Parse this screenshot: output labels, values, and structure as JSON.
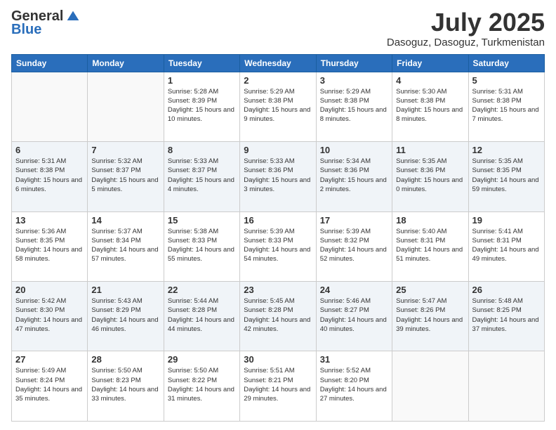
{
  "logo": {
    "general": "General",
    "blue": "Blue"
  },
  "title": {
    "month": "July 2025",
    "location": "Dasoguz, Dasoguz, Turkmenistan"
  },
  "headers": [
    "Sunday",
    "Monday",
    "Tuesday",
    "Wednesday",
    "Thursday",
    "Friday",
    "Saturday"
  ],
  "weeks": [
    [
      {
        "day": "",
        "info": ""
      },
      {
        "day": "",
        "info": ""
      },
      {
        "day": "1",
        "info": "Sunrise: 5:28 AM\nSunset: 8:39 PM\nDaylight: 15 hours and 10 minutes."
      },
      {
        "day": "2",
        "info": "Sunrise: 5:29 AM\nSunset: 8:38 PM\nDaylight: 15 hours and 9 minutes."
      },
      {
        "day": "3",
        "info": "Sunrise: 5:29 AM\nSunset: 8:38 PM\nDaylight: 15 hours and 8 minutes."
      },
      {
        "day": "4",
        "info": "Sunrise: 5:30 AM\nSunset: 8:38 PM\nDaylight: 15 hours and 8 minutes."
      },
      {
        "day": "5",
        "info": "Sunrise: 5:31 AM\nSunset: 8:38 PM\nDaylight: 15 hours and 7 minutes."
      }
    ],
    [
      {
        "day": "6",
        "info": "Sunrise: 5:31 AM\nSunset: 8:38 PM\nDaylight: 15 hours and 6 minutes."
      },
      {
        "day": "7",
        "info": "Sunrise: 5:32 AM\nSunset: 8:37 PM\nDaylight: 15 hours and 5 minutes."
      },
      {
        "day": "8",
        "info": "Sunrise: 5:33 AM\nSunset: 8:37 PM\nDaylight: 15 hours and 4 minutes."
      },
      {
        "day": "9",
        "info": "Sunrise: 5:33 AM\nSunset: 8:36 PM\nDaylight: 15 hours and 3 minutes."
      },
      {
        "day": "10",
        "info": "Sunrise: 5:34 AM\nSunset: 8:36 PM\nDaylight: 15 hours and 2 minutes."
      },
      {
        "day": "11",
        "info": "Sunrise: 5:35 AM\nSunset: 8:36 PM\nDaylight: 15 hours and 0 minutes."
      },
      {
        "day": "12",
        "info": "Sunrise: 5:35 AM\nSunset: 8:35 PM\nDaylight: 14 hours and 59 minutes."
      }
    ],
    [
      {
        "day": "13",
        "info": "Sunrise: 5:36 AM\nSunset: 8:35 PM\nDaylight: 14 hours and 58 minutes."
      },
      {
        "day": "14",
        "info": "Sunrise: 5:37 AM\nSunset: 8:34 PM\nDaylight: 14 hours and 57 minutes."
      },
      {
        "day": "15",
        "info": "Sunrise: 5:38 AM\nSunset: 8:33 PM\nDaylight: 14 hours and 55 minutes."
      },
      {
        "day": "16",
        "info": "Sunrise: 5:39 AM\nSunset: 8:33 PM\nDaylight: 14 hours and 54 minutes."
      },
      {
        "day": "17",
        "info": "Sunrise: 5:39 AM\nSunset: 8:32 PM\nDaylight: 14 hours and 52 minutes."
      },
      {
        "day": "18",
        "info": "Sunrise: 5:40 AM\nSunset: 8:31 PM\nDaylight: 14 hours and 51 minutes."
      },
      {
        "day": "19",
        "info": "Sunrise: 5:41 AM\nSunset: 8:31 PM\nDaylight: 14 hours and 49 minutes."
      }
    ],
    [
      {
        "day": "20",
        "info": "Sunrise: 5:42 AM\nSunset: 8:30 PM\nDaylight: 14 hours and 47 minutes."
      },
      {
        "day": "21",
        "info": "Sunrise: 5:43 AM\nSunset: 8:29 PM\nDaylight: 14 hours and 46 minutes."
      },
      {
        "day": "22",
        "info": "Sunrise: 5:44 AM\nSunset: 8:28 PM\nDaylight: 14 hours and 44 minutes."
      },
      {
        "day": "23",
        "info": "Sunrise: 5:45 AM\nSunset: 8:28 PM\nDaylight: 14 hours and 42 minutes."
      },
      {
        "day": "24",
        "info": "Sunrise: 5:46 AM\nSunset: 8:27 PM\nDaylight: 14 hours and 40 minutes."
      },
      {
        "day": "25",
        "info": "Sunrise: 5:47 AM\nSunset: 8:26 PM\nDaylight: 14 hours and 39 minutes."
      },
      {
        "day": "26",
        "info": "Sunrise: 5:48 AM\nSunset: 8:25 PM\nDaylight: 14 hours and 37 minutes."
      }
    ],
    [
      {
        "day": "27",
        "info": "Sunrise: 5:49 AM\nSunset: 8:24 PM\nDaylight: 14 hours and 35 minutes."
      },
      {
        "day": "28",
        "info": "Sunrise: 5:50 AM\nSunset: 8:23 PM\nDaylight: 14 hours and 33 minutes."
      },
      {
        "day": "29",
        "info": "Sunrise: 5:50 AM\nSunset: 8:22 PM\nDaylight: 14 hours and 31 minutes."
      },
      {
        "day": "30",
        "info": "Sunrise: 5:51 AM\nSunset: 8:21 PM\nDaylight: 14 hours and 29 minutes."
      },
      {
        "day": "31",
        "info": "Sunrise: 5:52 AM\nSunset: 8:20 PM\nDaylight: 14 hours and 27 minutes."
      },
      {
        "day": "",
        "info": ""
      },
      {
        "day": "",
        "info": ""
      }
    ]
  ]
}
